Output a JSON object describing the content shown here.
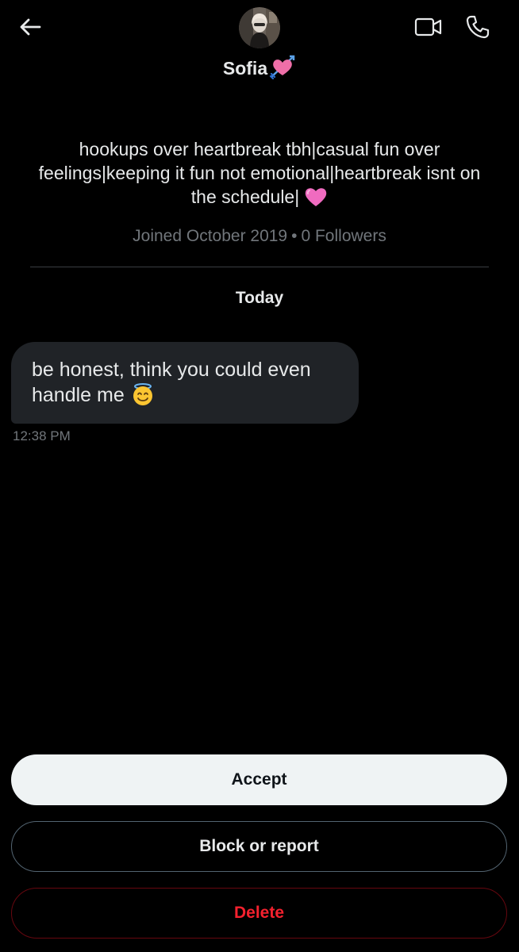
{
  "header": {
    "back_icon": "arrow-left-icon",
    "avatar_icon": "avatar-photo",
    "video_icon": "video-camera-icon",
    "call_icon": "phone-icon",
    "name": "Sofia",
    "name_emoji": "heart-with-arrow-emoji"
  },
  "profile": {
    "bio": "hookups over heartbreak tbh|casual fun over feelings|keeping it fun not emotional|heartbreak isnt on the schedule|",
    "bio_emoji": "pink-heart-emoji",
    "joined": "Joined October 2019",
    "separator": "•",
    "followers": "0 Followers"
  },
  "conversation": {
    "day_label": "Today",
    "messages": [
      {
        "text": "be honest, think you could even handle me",
        "emoji": "smiling-face-with-halo-emoji",
        "time": "12:38 PM"
      }
    ]
  },
  "actions": {
    "accept_label": "Accept",
    "block_label": "Block or report",
    "delete_label": "Delete"
  },
  "colors": {
    "background": "#000000",
    "text_primary": "#e7e9ea",
    "text_secondary": "#71767b",
    "bubble": "#202327",
    "accept_bg": "#eff3f4",
    "delete_red": "#f4212e"
  }
}
